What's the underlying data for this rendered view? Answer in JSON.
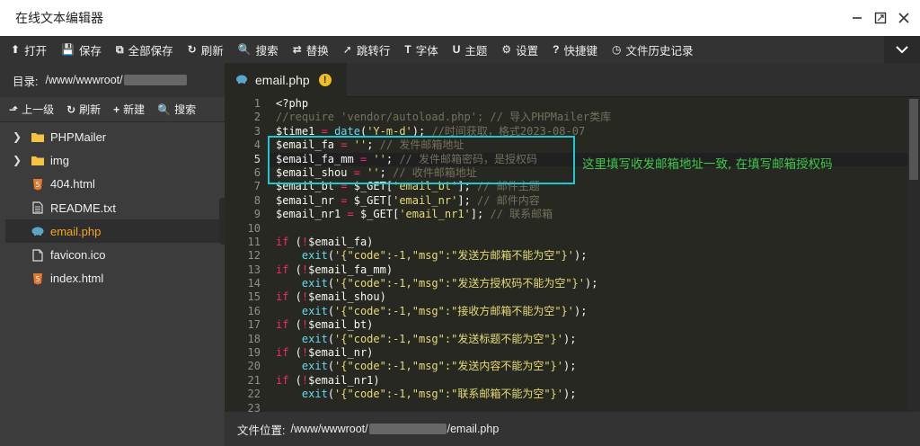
{
  "window": {
    "title": "在线文本编辑器"
  },
  "toolbar": {
    "items": [
      {
        "icon": "upload-icon",
        "glyph": "⬆",
        "label": "打开"
      },
      {
        "icon": "save-icon",
        "glyph": "💾",
        "label": "保存"
      },
      {
        "icon": "save-all-icon",
        "glyph": "⧉",
        "label": "全部保存"
      },
      {
        "icon": "refresh-icon",
        "glyph": "↻",
        "label": "刷新"
      },
      {
        "icon": "search-icon",
        "glyph": "🔍",
        "label": "搜索"
      },
      {
        "icon": "replace-icon",
        "glyph": "⇄",
        "label": "替换"
      },
      {
        "icon": "goto-line-icon",
        "glyph": "➚",
        "label": "跳转行"
      },
      {
        "icon": "font-icon",
        "glyph": "T",
        "label": "字体"
      },
      {
        "icon": "theme-icon",
        "glyph": "U",
        "label": "主题"
      },
      {
        "icon": "gear-icon",
        "glyph": "⚙",
        "label": "设置"
      },
      {
        "icon": "help-icon",
        "glyph": "?",
        "label": "快捷键"
      },
      {
        "icon": "history-icon",
        "glyph": "◷",
        "label": "文件历史记录"
      }
    ]
  },
  "sidebar": {
    "dir_label": "目录:",
    "dir_path": "/www/wwwroot/",
    "tools": [
      {
        "icon": "arrow-up-icon",
        "glyph": "⬏",
        "label": "上一级"
      },
      {
        "icon": "refresh-icon",
        "glyph": "↻",
        "label": "刷新"
      },
      {
        "icon": "plus-icon",
        "glyph": "+",
        "label": "新建"
      },
      {
        "icon": "search-icon",
        "glyph": "🔍",
        "label": "搜索"
      }
    ],
    "files": [
      {
        "name": "PHPMailer",
        "type": "folder"
      },
      {
        "name": "img",
        "type": "folder"
      },
      {
        "name": "404.html",
        "type": "html"
      },
      {
        "name": "README.txt",
        "type": "txt"
      },
      {
        "name": "email.php",
        "type": "php"
      },
      {
        "name": "favicon.ico",
        "type": "file"
      },
      {
        "name": "index.html",
        "type": "html"
      }
    ]
  },
  "editor": {
    "tab": {
      "label": "email.php",
      "modified_marker": "!"
    },
    "annotation": "这里填写收发邮箱地址一致, 在填写邮箱授权码",
    "lines": [
      "<?php",
      "//require 'vendor/autoload.php'; // 导入PHPMailer类库",
      "$time1 = date('Y-m-d'); //时间获取，格式2023-08-07",
      "$email_fa = ''; // 发件邮箱地址",
      "$email_fa_mm = ''; // 发件邮箱密码，是授权码",
      "$email_shou = ''; // 收件邮箱地址",
      "$email_bt = $_GET['email_bt']; // 邮件主题",
      "$email_nr = $_GET['email_nr']; // 邮件内容",
      "$email_nr1 = $_GET['email_nr1']; // 联系邮箱",
      "",
      "if (!$email_fa)",
      "    exit('{\"code\":-1,\"msg\":\"发送方邮箱不能为空\"}');",
      "if (!$email_fa_mm)",
      "    exit('{\"code\":-1,\"msg\":\"发送方授权码不能为空\"}');",
      "if (!$email_shou)",
      "    exit('{\"code\":-1,\"msg\":\"接收方邮箱不能为空\"}');",
      "if (!$email_bt)",
      "    exit('{\"code\":-1,\"msg\":\"发送标题不能为空\"}');",
      "if (!$email_nr)",
      "    exit('{\"code\":-1,\"msg\":\"发送内容不能为空\"}');",
      "if (!$email_nr1)",
      "    exit('{\"code\":-1,\"msg\":\"联系邮箱不能为空\"}');",
      ""
    ],
    "current_line": 5
  },
  "status": {
    "label": "文件位置:",
    "path_prefix": "/www/wwwroot/",
    "path_suffix": "/email.php"
  },
  "colors": {
    "folder": "#f5c242",
    "html": "#e8772e",
    "php": "#5aa5c9",
    "keyword": "#f92672",
    "string": "#e6db74",
    "comment": "#75715e",
    "func": "#66d9ef",
    "annotation": "#3ec84a",
    "box": "#1fc7d4"
  }
}
